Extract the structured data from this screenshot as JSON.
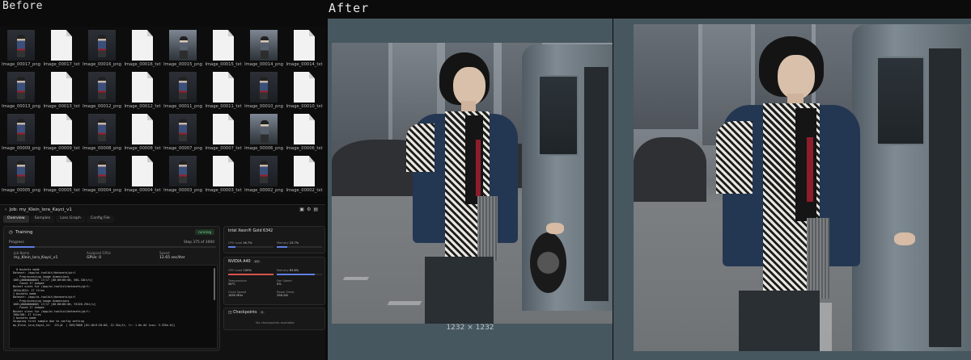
{
  "labels": {
    "before": "Before",
    "after": "After"
  },
  "files": [
    {
      "name": "Image_00017_png",
      "type": "image",
      "thumb": "dark"
    },
    {
      "name": "Image_00017_txt",
      "type": "text"
    },
    {
      "name": "Image_00016_png",
      "type": "image",
      "thumb": "dark"
    },
    {
      "name": "Image_00016_txt",
      "type": "text"
    },
    {
      "name": "Image_00015_png",
      "type": "image",
      "thumb": "wide"
    },
    {
      "name": "Image_00015_txt",
      "type": "text"
    },
    {
      "name": "Image_00014_png",
      "type": "image",
      "thumb": "wide"
    },
    {
      "name": "Image_00014_txt",
      "type": "text"
    },
    {
      "name": "Image_00013_png",
      "type": "image",
      "thumb": "dark"
    },
    {
      "name": "Image_00013_txt",
      "type": "text"
    },
    {
      "name": "Image_00012_png",
      "type": "image",
      "thumb": "dark"
    },
    {
      "name": "Image_00012_txt",
      "type": "text"
    },
    {
      "name": "Image_00011_png",
      "type": "image",
      "thumb": "dark"
    },
    {
      "name": "Image_00011_txt",
      "type": "text"
    },
    {
      "name": "Image_00010_png",
      "type": "image",
      "thumb": "dark"
    },
    {
      "name": "Image_00010_txt",
      "type": "text"
    },
    {
      "name": "Image_00009_png",
      "type": "image",
      "thumb": "dark"
    },
    {
      "name": "Image_00009_txt",
      "type": "text"
    },
    {
      "name": "Image_00008_png",
      "type": "image",
      "thumb": "dark"
    },
    {
      "name": "Image_00008_txt",
      "type": "text"
    },
    {
      "name": "Image_00007_png",
      "type": "image",
      "thumb": "dark"
    },
    {
      "name": "Image_00007_txt",
      "type": "text"
    },
    {
      "name": "Image_00006_png",
      "type": "image",
      "thumb": "wide"
    },
    {
      "name": "Image_00006_txt",
      "type": "text"
    },
    {
      "name": "Image_00005_png",
      "type": "image",
      "thumb": "dark"
    },
    {
      "name": "Image_00005_txt",
      "type": "text"
    },
    {
      "name": "Image_00004_png",
      "type": "image",
      "thumb": "dark"
    },
    {
      "name": "Image_00004_txt",
      "type": "text"
    },
    {
      "name": "Image_00003_png",
      "type": "image",
      "thumb": "dark"
    },
    {
      "name": "Image_00003_txt",
      "type": "text"
    },
    {
      "name": "Image_00002_png",
      "type": "image",
      "thumb": "dark"
    },
    {
      "name": "Image_00002_txt",
      "type": "text"
    }
  ],
  "job": {
    "title": "Job: my_Klein_lora_Kayci_v1",
    "tabs": [
      "Overview",
      "Samples",
      "Loss Graph",
      "Config File"
    ],
    "active_tab": 0,
    "training": {
      "title": "Training",
      "status": "running",
      "progress_label": "Progress",
      "step_text": "Step 375 of 3000",
      "progress_fraction": 0.125,
      "stats": [
        {
          "label": "Job Name",
          "value": "my_Klein_lora_Kayci_v1"
        },
        {
          "label": "Assigned GPUs",
          "value": "GPUs: 0"
        },
        {
          "label": "Speed",
          "value": "12.65 sec/iter"
        }
      ],
      "log": "  0 buckets made\nDataset: /app/ai-toolkit/datasets/girl\n  - Preprocessing image dimensions\n100%|##########| 17/17 [00:00<00:00, 861.18it/s]\n  - Found 17 images\nBucket sizes for /app/ai-toolkit/datasets/girl:\n1024x1024: 17 files\n1 buckets made\nDataset: /app/ai-toolkit/datasets/girl\n  - Preprocessing image dimensions\n100%|##########| 17/17 [00:00<00:00, 91320.29it/s]\n  - Found 17 images\nBucket sizes for /app/ai-toolkit/datasets/girl:\n768x768: 17 files\n1 buckets made\nSkipping first sample due to config setting\nmy_Klein_lora_Kayci_v1:  12%|#  | 369/3000 [01:18<9:20:00, 12.35s/it, lr: 1.0e-04 loss: 3.335e-01]"
    },
    "cpu": {
      "title": "Intel Xeon® Gold 6342",
      "metrics": [
        {
          "label": "CPU Load",
          "value": "16.7%",
          "fraction": 0.167,
          "color": "#5f7fe0"
        },
        {
          "label": "Memory",
          "value": "23.7%",
          "fraction": 0.237,
          "color": "#5f7fe0"
        }
      ]
    },
    "gpu": {
      "title": "NVIDIA A40",
      "badge": "#0",
      "metrics": [
        {
          "label": "GPU Load",
          "value": "100%",
          "fraction": 1.0,
          "color": "#d9534f"
        },
        {
          "label": "Memory",
          "value": "83.8%",
          "fraction": 0.838,
          "color": "#5f7fe0"
        }
      ],
      "details": [
        {
          "label": "Temperature",
          "value": "56°C"
        },
        {
          "label": "Fan Speed",
          "value": "0%"
        },
        {
          "label": "Clock Speed",
          "value": "1650 MHz"
        },
        {
          "label": "Power Draw",
          "value": "298.2W"
        }
      ]
    },
    "checkpoints": {
      "title": "Checkpoints",
      "count": "0",
      "empty_text": "No checkpoints available"
    }
  },
  "after": {
    "dimensions": "1232 × 1232"
  }
}
